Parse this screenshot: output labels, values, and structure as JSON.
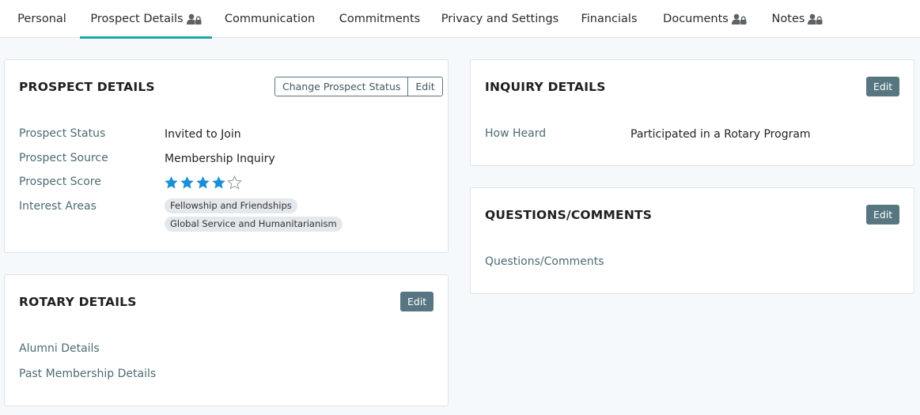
{
  "tabs": [
    {
      "label": "Personal",
      "locked": false,
      "active": false
    },
    {
      "label": "Prospect Details",
      "locked": true,
      "active": true
    },
    {
      "label": "Communication",
      "locked": false,
      "active": false
    },
    {
      "label": "Commitments",
      "locked": false,
      "active": false
    },
    {
      "label": "Privacy and Settings",
      "locked": false,
      "active": false
    },
    {
      "label": "Financials",
      "locked": false,
      "active": false
    },
    {
      "label": "Documents",
      "locked": true,
      "active": false
    },
    {
      "label": "Notes",
      "locked": true,
      "active": false
    }
  ],
  "prospect_details": {
    "title": "PROSPECT DETAILS",
    "change_status_label": "Change Prospect Status",
    "edit_label": "Edit",
    "status_label": "Prospect Status",
    "status_value": "Invited to Join",
    "source_label": "Prospect Source",
    "source_value": "Membership Inquiry",
    "score_label": "Prospect Score",
    "score_value": 4,
    "score_max": 5,
    "interest_label": "Interest Areas",
    "interests": [
      "Fellowship and Friendships",
      "Global Service and Humanitarianism"
    ]
  },
  "rotary_details": {
    "title": "ROTARY DETAILS",
    "edit_label": "Edit",
    "alumni_label": "Alumni Details",
    "past_membership_label": "Past Membership Details"
  },
  "inquiry_details": {
    "title": "INQUIRY DETAILS",
    "edit_label": "Edit",
    "how_heard_label": "How Heard",
    "how_heard_value": "Participated in a Rotary Program"
  },
  "questions_comments": {
    "title": "QUESTIONS/COMMENTS",
    "edit_label": "Edit",
    "field_label": "Questions/Comments"
  },
  "colors": {
    "accent": "#1ba9a6",
    "button": "#587681",
    "star": "#1a8fd6",
    "label": "#4d6b73"
  },
  "icons": {
    "lock": "user-lock-icon",
    "star_filled": "star-filled-icon",
    "star_empty": "star-empty-icon"
  }
}
